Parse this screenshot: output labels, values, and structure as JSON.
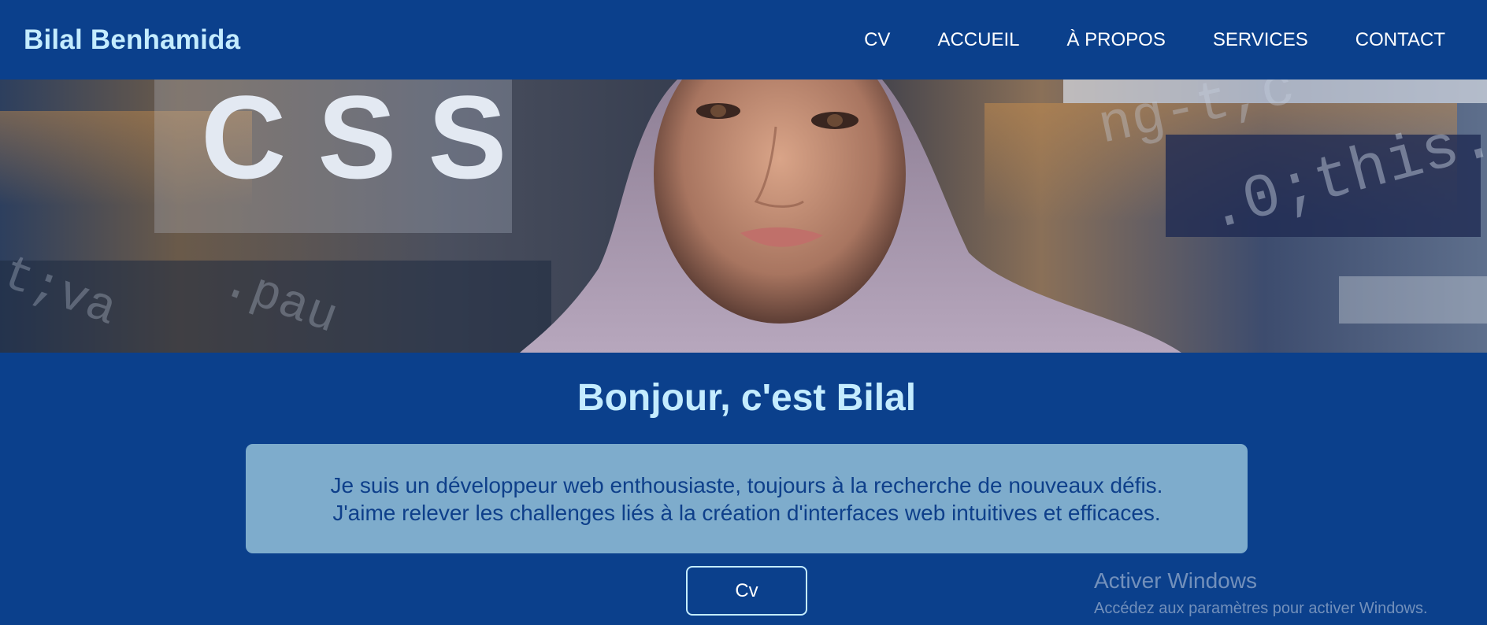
{
  "header": {
    "brand": "Bilal Benhamida",
    "nav": [
      {
        "label": "CV"
      },
      {
        "label": "ACCUEIL"
      },
      {
        "label": "À PROPOS"
      },
      {
        "label": "SERVICES"
      },
      {
        "label": "CONTACT"
      }
    ]
  },
  "hero": {
    "banner_text": "CSS",
    "code_text_1": "ng-t,c",
    "code_text_2": ".0;this.",
    "code_text_3": "t;va",
    "code_text_4": ".pau",
    "title": "Bonjour, c'est Bilal"
  },
  "about": {
    "line1": "Je suis un développeur web enthousiaste, toujours à la recherche de nouveaux défis.",
    "line2": "J'aime relever les challenges liés à la création d'interfaces web intuitives et efficaces."
  },
  "cta": {
    "label": "Cv"
  },
  "watermark": {
    "title": "Activer Windows",
    "subtitle": "Accédez aux paramètres pour activer Windows."
  },
  "colors": {
    "background": "#0b408c",
    "brand_text": "#c4ecff",
    "about_box": "#7eaccc",
    "about_text": "#0e3f8a"
  }
}
